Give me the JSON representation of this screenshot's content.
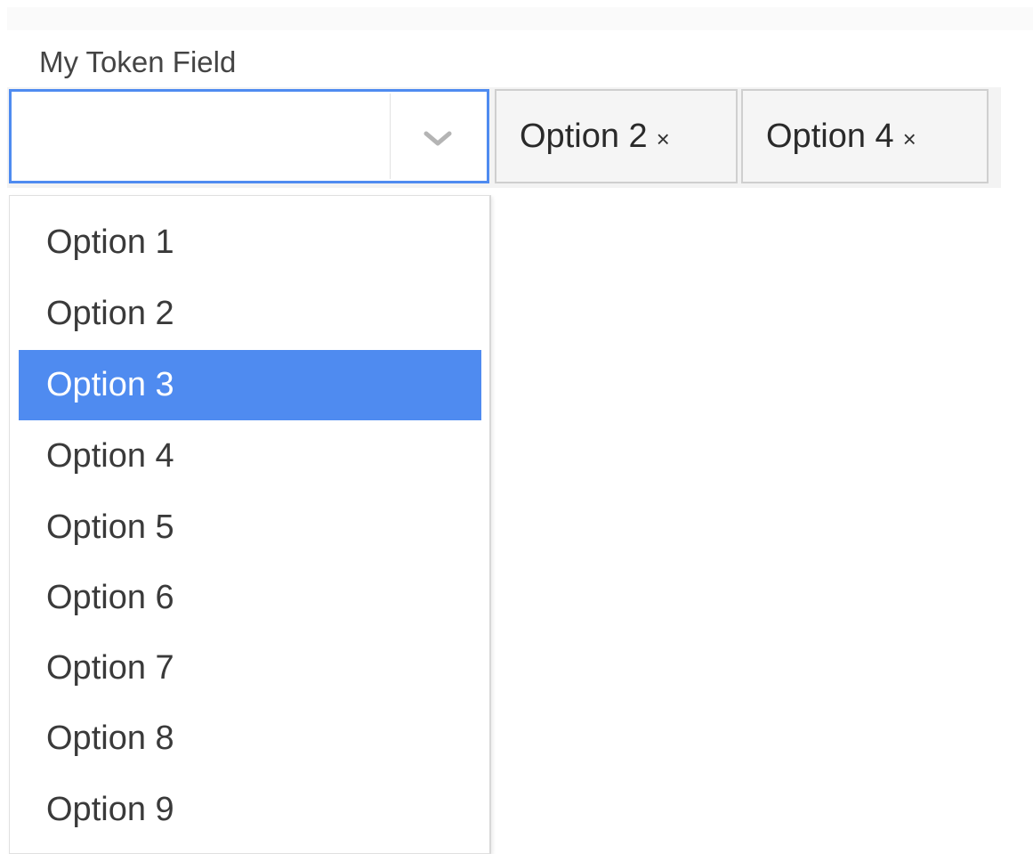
{
  "field": {
    "label": "My Token Field",
    "input_value": "",
    "dropdown_icon": "chevron-down-icon"
  },
  "tokens": [
    {
      "label": "Option 2",
      "remove": "×"
    },
    {
      "label": "Option 4",
      "remove": "×"
    }
  ],
  "options": [
    {
      "label": "Option 1",
      "selected": false
    },
    {
      "label": "Option 2",
      "selected": false
    },
    {
      "label": "Option 3",
      "selected": true
    },
    {
      "label": "Option 4",
      "selected": false
    },
    {
      "label": "Option 5",
      "selected": false
    },
    {
      "label": "Option 6",
      "selected": false
    },
    {
      "label": "Option 7",
      "selected": false
    },
    {
      "label": "Option 8",
      "selected": false
    },
    {
      "label": "Option 9",
      "selected": false
    }
  ],
  "colors": {
    "accent": "#4f8bf0",
    "highlight_text": "#ffffff"
  }
}
